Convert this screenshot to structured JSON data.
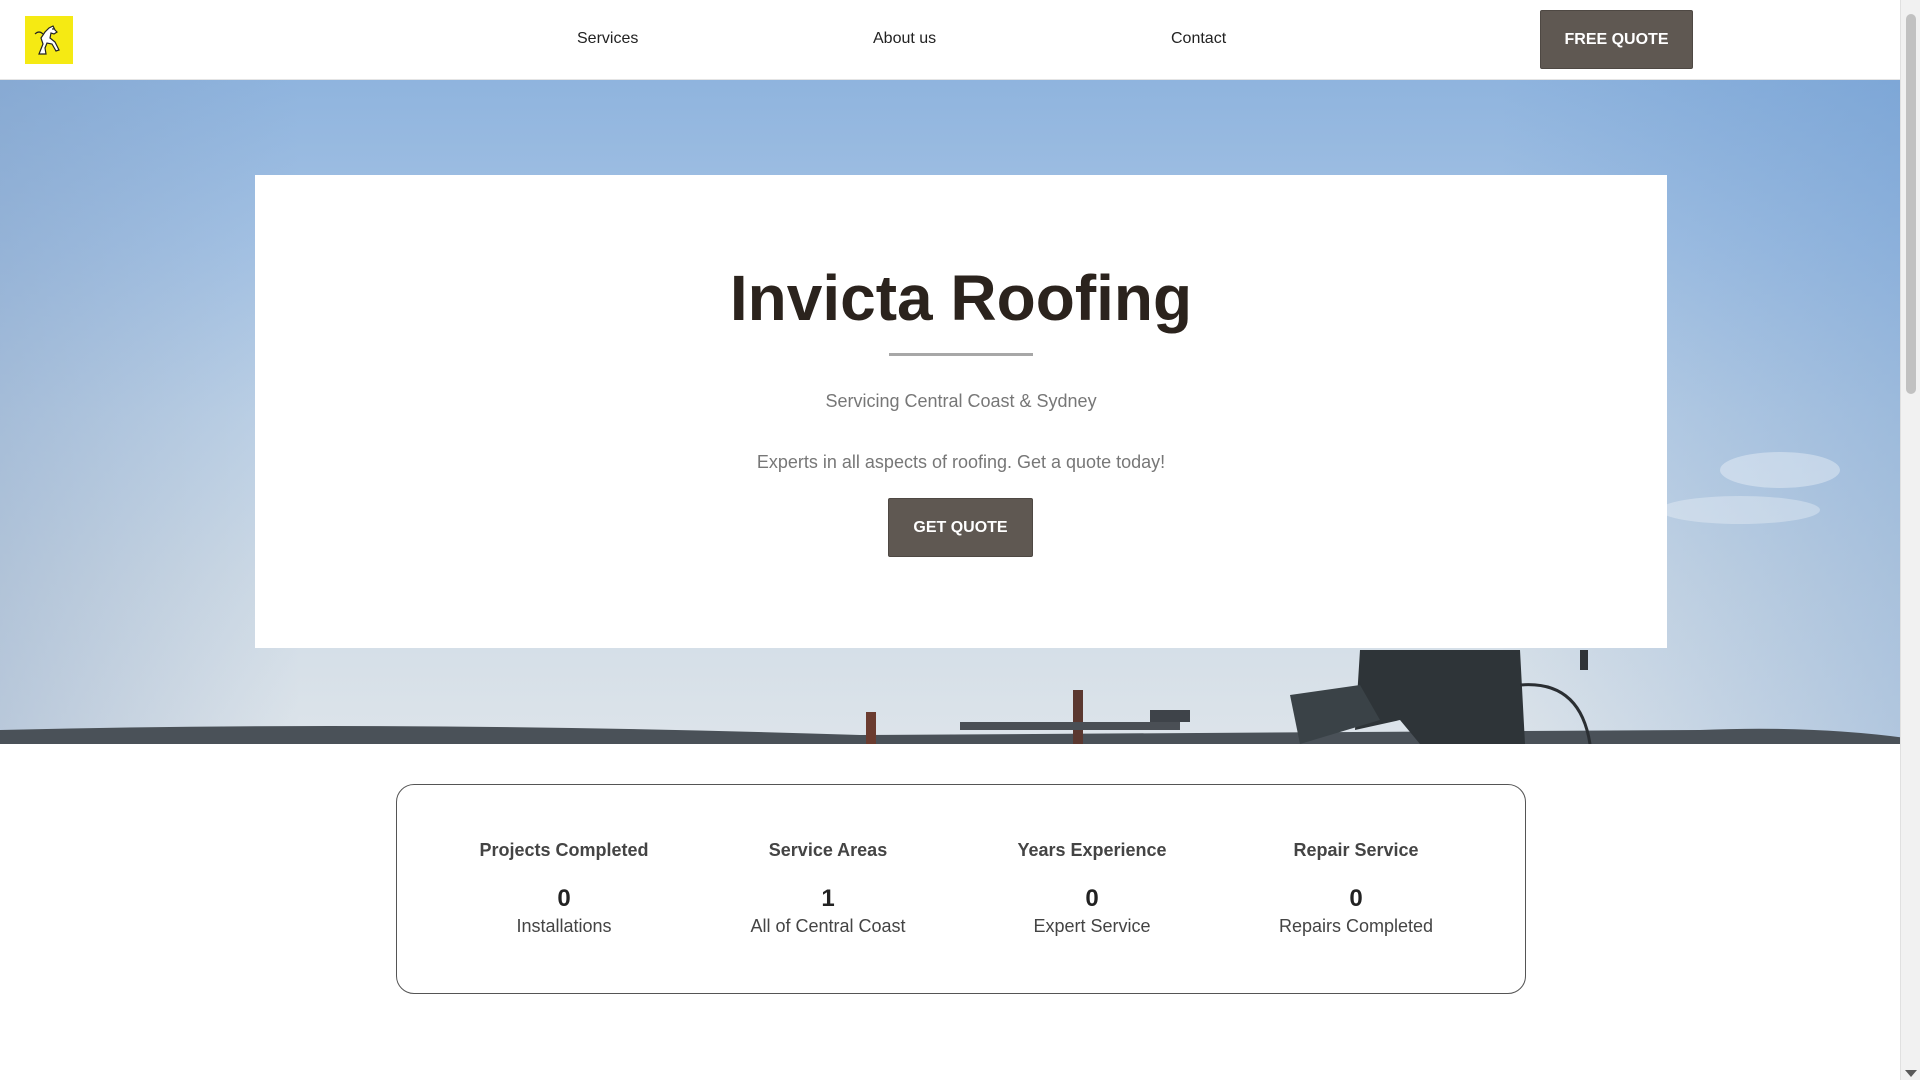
{
  "header": {
    "logo_icon": "horse-logo-icon",
    "logo_color": "#f5ea13",
    "nav": {
      "services": "Services",
      "about": "About us",
      "contact": "Contact"
    },
    "cta_label": "FREE QUOTE"
  },
  "hero": {
    "title": "Invicta Roofing",
    "subtitle": "Servicing Central Coast & Sydney",
    "tagline": "Experts in all aspects of roofing. Get a quote today!",
    "button_label": "GET QUOTE"
  },
  "stats": [
    {
      "title": "Projects Completed",
      "value": "0",
      "label": "Installations"
    },
    {
      "title": "Service Areas",
      "value": "1",
      "label": "All of Central Coast"
    },
    {
      "title": "Years Experience",
      "value": "0",
      "label": "Expert Service"
    },
    {
      "title": "Repair Service",
      "value": "0",
      "label": "Repairs Completed"
    }
  ],
  "colors": {
    "button_bg": "#5f5852",
    "title_text": "#2b231d"
  }
}
